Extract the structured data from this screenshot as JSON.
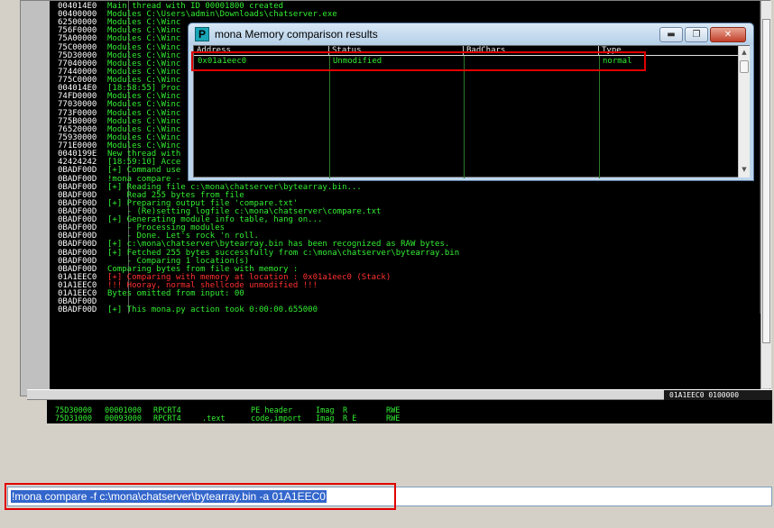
{
  "log": {
    "lines": [
      {
        "addr": "004014E0",
        "msg": "Main thread with ID 00001800 created",
        "color": "green"
      },
      {
        "addr": "00400000",
        "msg": "Modules C:\\Users\\admin\\Downloads\\chatserver.exe",
        "color": "green"
      },
      {
        "addr": "62500000",
        "msg": "Modules C:\\Winc",
        "color": "green"
      },
      {
        "addr": "756F0000",
        "msg": "Modules C:\\Winc",
        "color": "green"
      },
      {
        "addr": "75A00000",
        "msg": "Modules C:\\Winc",
        "color": "green"
      },
      {
        "addr": "75C00000",
        "msg": "Modules C:\\Winc",
        "color": "green"
      },
      {
        "addr": "75D30000",
        "msg": "Modules C:\\Winc",
        "color": "green"
      },
      {
        "addr": "77040000",
        "msg": "Modules C:\\Winc",
        "color": "green"
      },
      {
        "addr": "77440000",
        "msg": "Modules C:\\Winc",
        "color": "green"
      },
      {
        "addr": "775C0000",
        "msg": "Modules C:\\Winc",
        "color": "green"
      },
      {
        "addr": "004014E0",
        "msg": "[18:58:55] Proc",
        "color": "green"
      },
      {
        "addr": "74FD0000",
        "msg": "Modules C:\\Winc",
        "color": "green"
      },
      {
        "addr": "77030000",
        "msg": "Modules C:\\Winc",
        "color": "green"
      },
      {
        "addr": "773F0000",
        "msg": "Modules C:\\Winc",
        "color": "green"
      },
      {
        "addr": "775B0000",
        "msg": "Modules C:\\Winc",
        "color": "green"
      },
      {
        "addr": "76520000",
        "msg": "Modules C:\\Winc",
        "color": "green"
      },
      {
        "addr": "75930000",
        "msg": "Modules C:\\Winc",
        "color": "green"
      },
      {
        "addr": "771E0000",
        "msg": "Modules C:\\Winc",
        "color": "green"
      },
      {
        "addr": "0040199E",
        "msg": "New thread with",
        "color": "green"
      },
      {
        "addr": "42424242",
        "msg": "[18:59:10] Acce",
        "color": "green"
      },
      {
        "addr": "0BADF00D",
        "msg": "[+] Command use",
        "color": "green"
      },
      {
        "addr": "0BADF00D",
        "msg": "!mona compare -",
        "color": "green"
      },
      {
        "addr": "0BADF00D",
        "msg": "[+] Reading file c:\\mona\\chatserver\\bytearray.bin...",
        "color": "green"
      },
      {
        "addr": "0BADF00D",
        "msg": "    Read 255 bytes from file",
        "color": "green"
      },
      {
        "addr": "0BADF00D",
        "msg": "[+] Preparing output file 'compare.txt'",
        "color": "green"
      },
      {
        "addr": "0BADF00D",
        "msg": "    - (Re)setting logfile c:\\mona\\chatserver\\compare.txt",
        "color": "green"
      },
      {
        "addr": "0BADF00D",
        "msg": "[+] Generating module info table, hang on...",
        "color": "green"
      },
      {
        "addr": "0BADF00D",
        "msg": "    - Processing modules",
        "color": "green"
      },
      {
        "addr": "0BADF00D",
        "msg": "    - Done. Let's rock 'n roll.",
        "color": "green"
      },
      {
        "addr": "0BADF00D",
        "msg": "[+] c:\\mona\\chatserver\\bytearray.bin has been recognized as RAW bytes.",
        "color": "green"
      },
      {
        "addr": "0BADF00D",
        "msg": "[+] Fetched 255 bytes successfully from c:\\mona\\chatserver\\bytearray.bin",
        "color": "green"
      },
      {
        "addr": "0BADF00D",
        "msg": "    - Comparing 1 location(s)",
        "color": "green"
      },
      {
        "addr": "0BADF00D",
        "msg": "Comparing bytes from file with memory :",
        "color": "green"
      },
      {
        "addr": "01A1EEC0",
        "msg": "[+] Comparing with memory at location : 0x01a1eec0 (Stack)",
        "color": "red"
      },
      {
        "addr": "01A1EEC0",
        "msg": "!!! Hooray, normal shellcode unmodified !!!",
        "color": "red"
      },
      {
        "addr": "01A1EEC0",
        "msg": "Bytes omitted from input: 00",
        "color": "green"
      },
      {
        "addr": "0BADF00D",
        "msg": "",
        "color": "green"
      },
      {
        "addr": "0BADF00D",
        "msg": "[+] This mona.py action took 0:00:00.655000",
        "color": "green"
      }
    ]
  },
  "splitter": {
    "right_text": "01A1EEC0 0100000"
  },
  "modules": {
    "rows": [
      {
        "base": "75D30000",
        "size": "00001000",
        "name": "RPCRT4",
        "section": "",
        "contains": "PE header",
        "type": "Imag",
        "access": "R",
        "initial": "RWE"
      },
      {
        "base": "75D31000",
        "size": "00093000",
        "name": "RPCRT4",
        "section": ".text",
        "contains": "code,import",
        "type": "Imag",
        "access": "R E",
        "initial": "RWE"
      }
    ]
  },
  "mona_dialog": {
    "title": "mona Memory comparison results",
    "icon_letter": "P",
    "min_glyph": "▬",
    "max_glyph": "❐",
    "close_glyph": "✕",
    "columns": [
      "Address",
      "Status",
      "BadChars",
      "Type"
    ],
    "rows": [
      {
        "address": "0x01a1eec0",
        "status": "Unmodified",
        "badchars": "",
        "type": "normal"
      }
    ],
    "scroll_up": "▲",
    "scroll_down": "▼"
  },
  "command_bar": {
    "value": "!mona compare -f c:\\mona\\chatserver\\bytearray.bin -a 01A1EEC0"
  },
  "colors": {
    "log_green": "#33ee33",
    "log_red": "#ff3030",
    "highlight_red": "#e00000",
    "selection_blue": "#3366cc"
  }
}
